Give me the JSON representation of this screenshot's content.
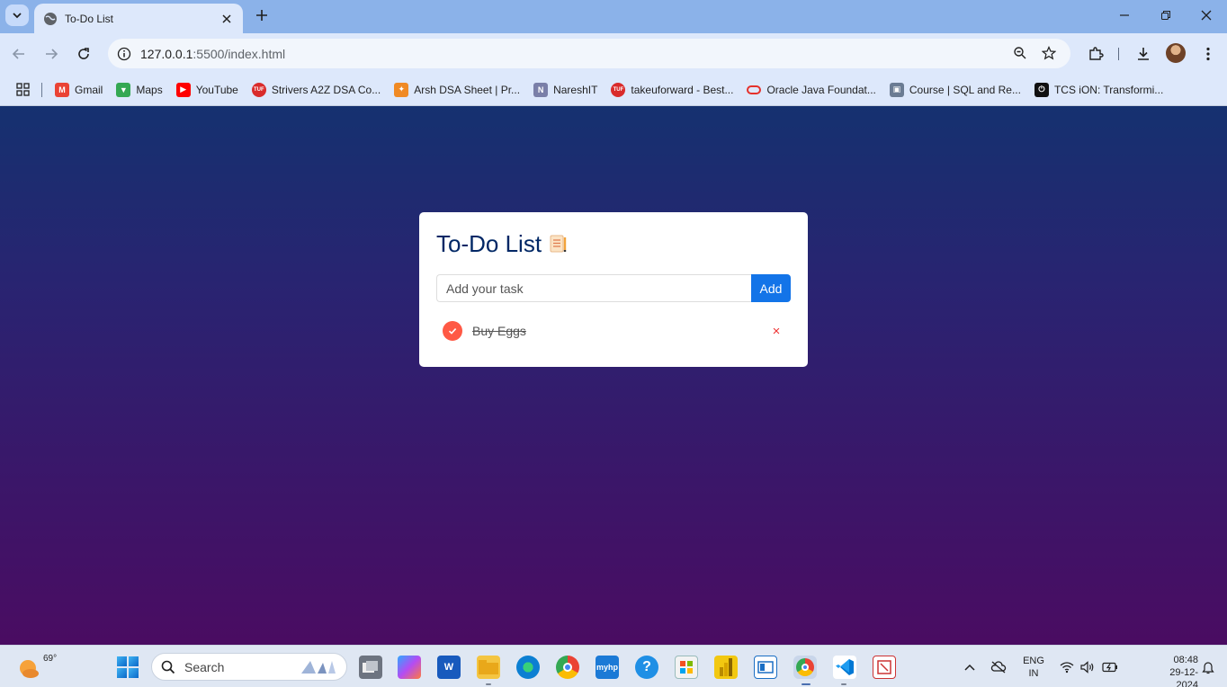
{
  "browser": {
    "tab_title": "To-Do List",
    "url_host": "127.0.0.1",
    "url_path": ":5500/index.html",
    "bookmarks": [
      {
        "label": "Gmail",
        "icon": "gmail-icon",
        "color": "#ea4335"
      },
      {
        "label": "Maps",
        "icon": "maps-icon",
        "color": "#34a853"
      },
      {
        "label": "YouTube",
        "icon": "youtube-icon",
        "color": "#ff0000"
      },
      {
        "label": "Strivers A2Z DSA Co...",
        "icon": "tuf-icon",
        "color": "#d92b2b"
      },
      {
        "label": "Arsh DSA Sheet | Pr...",
        "icon": "arsh-icon",
        "color": "#f08a24"
      },
      {
        "label": "NareshIT",
        "icon": "nareshit-icon",
        "color": "#7a7fa8"
      },
      {
        "label": "takeuforward - Best...",
        "icon": "tuf-icon",
        "color": "#d92b2b"
      },
      {
        "label": "Oracle Java Foundat...",
        "icon": "oracle-icon",
        "color": "#e5312b"
      },
      {
        "label": "Course | SQL and Re...",
        "icon": "course-icon",
        "color": "#6b7c93"
      },
      {
        "label": "TCS iON: Transformi...",
        "icon": "tcs-power-icon",
        "color": "#111111"
      }
    ]
  },
  "app": {
    "title": "To-Do List",
    "input_placeholder": "Add your task",
    "add_label": "Add",
    "tasks": [
      {
        "text": "Buy Eggs",
        "checked": true
      }
    ],
    "remove_glyph": "×",
    "colors": {
      "accent": "#1374e8",
      "check": "#ff5945",
      "title": "#002765"
    }
  },
  "taskbar": {
    "weather_temp": "69°",
    "search_label": "Search",
    "lang_top": "ENG",
    "lang_bottom": "IN",
    "time": "08:48",
    "date": "29-12-2024"
  }
}
